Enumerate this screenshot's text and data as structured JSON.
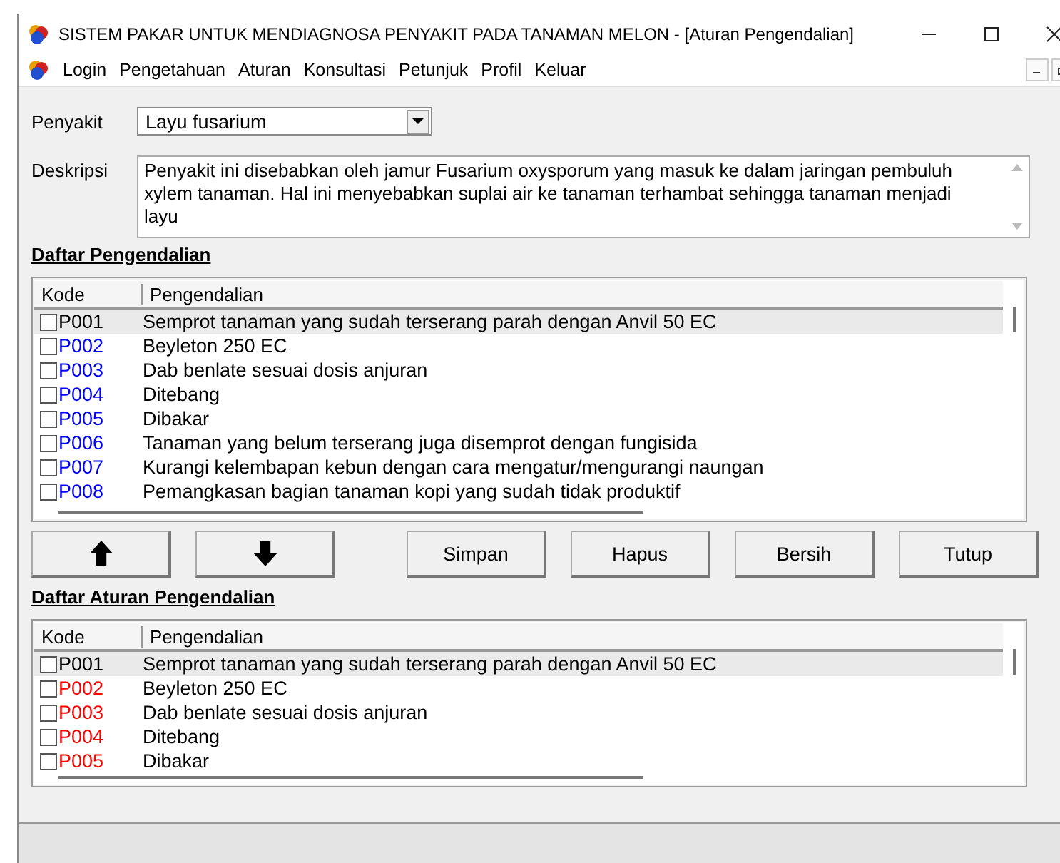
{
  "window": {
    "title": "SISTEM  PAKAR UNTUK MENDIAGNOSA PENYAKIT PADA TANAMAN MELON - [Aturan Pengendalian]"
  },
  "menu": [
    "Login",
    "Pengetahuan",
    "Aturan",
    "Konsultasi",
    "Petunjuk",
    "Profil",
    "Keluar"
  ],
  "penyakit": {
    "label": "Penyakit",
    "value": "Layu fusarium"
  },
  "deskripsi": {
    "label": "Deskripsi",
    "value": "Penyakit ini disebabkan oleh jamur Fusarium oxysporum yang masuk ke dalam jaringan pembuluh xylem tanaman. Hal ini menyebabkan suplai air ke tanaman terhambat sehingga tanaman menjadi layu"
  },
  "daftar_pengendalian": {
    "title": "Daftar Pengendalian",
    "columns": [
      "Kode",
      "Pengendalian"
    ],
    "rows": [
      {
        "code": "P001",
        "text": "Semprot tanaman yang sudah terserang parah dengan Anvil 50 EC",
        "checked": false,
        "selected": true,
        "color": "#000000"
      },
      {
        "code": "P002",
        "text": "Beyleton 250 EC",
        "checked": false,
        "selected": false,
        "color": "#0000ff"
      },
      {
        "code": "P003",
        "text": "Dab benlate sesuai dosis anjuran",
        "checked": false,
        "selected": false,
        "color": "#0000ff"
      },
      {
        "code": "P004",
        "text": "Ditebang",
        "checked": false,
        "selected": false,
        "color": "#0000ff"
      },
      {
        "code": "P005",
        "text": "Dibakar",
        "checked": false,
        "selected": false,
        "color": "#0000ff"
      },
      {
        "code": "P006",
        "text": "Tanaman yang belum terserang juga disemprot dengan fungisida",
        "checked": false,
        "selected": false,
        "color": "#0000ff"
      },
      {
        "code": "P007",
        "text": "Kurangi kelembapan kebun dengan cara mengatur/mengurangi naungan",
        "checked": false,
        "selected": false,
        "color": "#0000ff"
      },
      {
        "code": "P008",
        "text": "Pemangkasan bagian tanaman kopi yang sudah tidak produktif",
        "checked": false,
        "selected": false,
        "color": "#0000ff"
      }
    ]
  },
  "buttons": [
    "Simpan",
    "Hapus",
    "Bersih",
    "Tutup"
  ],
  "daftar_aturan": {
    "title": "Daftar Aturan Pengendalian",
    "columns": [
      "Kode",
      "Pengendalian"
    ],
    "rows": [
      {
        "code": "P001",
        "text": "Semprot tanaman yang sudah terserang parah dengan Anvil 50 EC",
        "checked": false,
        "selected": true,
        "color": "#000000"
      },
      {
        "code": "P002",
        "text": "Beyleton 250 EC",
        "checked": false,
        "selected": false,
        "color": "#ff0000"
      },
      {
        "code": "P003",
        "text": "Dab benlate sesuai dosis anjuran",
        "checked": false,
        "selected": false,
        "color": "#ff0000"
      },
      {
        "code": "P004",
        "text": "Ditebang",
        "checked": false,
        "selected": false,
        "color": "#ff0000"
      },
      {
        "code": "P005",
        "text": "Dibakar",
        "checked": false,
        "selected": false,
        "color": "#ff0000"
      }
    ]
  }
}
